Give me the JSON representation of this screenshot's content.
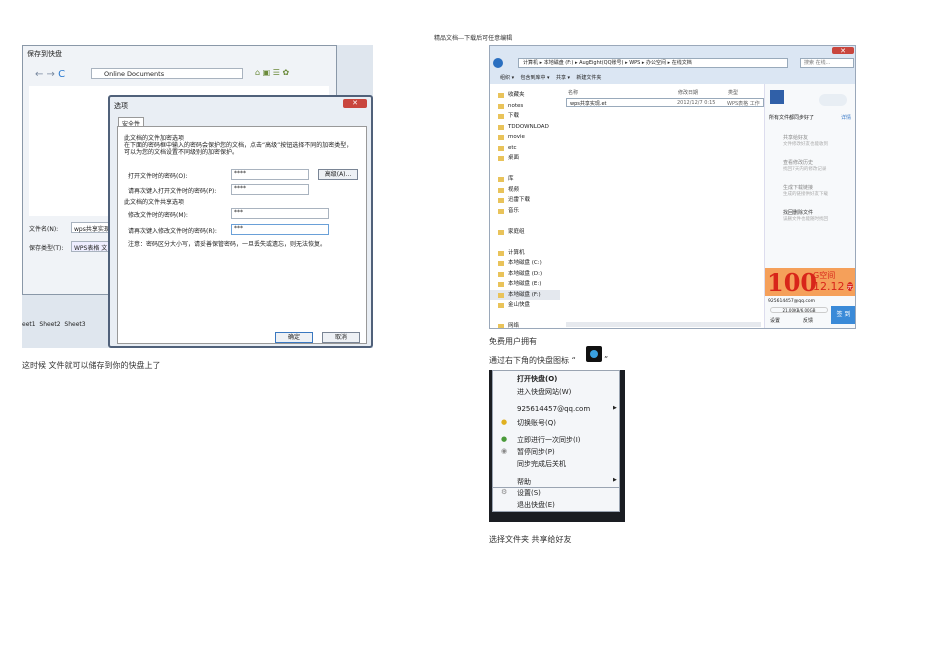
{
  "header": "精品文档---下载后可任意编辑",
  "shot1": {
    "save_title": "保存到快盘",
    "location": "Online Documents",
    "filename_label": "文件名(N):",
    "filename": "wps共享实现",
    "filetype_label": "保存类型(T):",
    "filetype": "WPS表格 文",
    "sheets": [
      "eet1",
      "Sheet2",
      "Sheet3"
    ],
    "dialog_title": "选项",
    "tab": "安全性",
    "enc_section": "此文档的文件加密选项",
    "enc_desc": "在下面的密码框中输入的密码会保护您的文档，点击“高级”按钮选择不同的加密类型，可以为您的文档设置不同级别的加密保护。",
    "open_pw_label": "打开文件时的密码(O):",
    "open_pw": "****",
    "advanced": "高级(A)...",
    "open_pw2_label": "请再次键入打开文件时的密码(P):",
    "open_pw2": "****",
    "share_section": "此文档的文件共享选项",
    "mod_pw_label": "修改文件时的密码(M):",
    "mod_pw": "***",
    "mod_pw2_label": "请再次键入修改文件时的密码(R):",
    "mod_pw2": "***",
    "note": "注意：密码区分大小写，请妥善保管密码，一旦丢失或遗忘，则无法恢复。",
    "ok": "确定",
    "cancel": "取消"
  },
  "caption1": "这时候  文件就可以储存到你的快盘上了",
  "shot2": {
    "breadcrumb": [
      "计算机",
      "本地磁盘 (F:)",
      "AugEight(QQ账号)",
      "WPS",
      "办公空间",
      "在线文档"
    ],
    "search": "搜索 在线...",
    "toolbar": [
      "组织 ▾",
      "包含到库中 ▾",
      "共享 ▾",
      "新建文件夹"
    ],
    "columns": [
      "名称",
      "修改日期",
      "类型"
    ],
    "file": {
      "name": "wps共享实现.et",
      "date": "2012/12/7 0:15",
      "type": "WPS表格 工作"
    },
    "nav": [
      "收藏夹",
      "notes",
      "下载",
      "TDDOWNLOAD",
      "movie",
      "etc",
      "桌面",
      "",
      "库",
      "视频",
      "迅雷下载",
      "音乐",
      "",
      "家庭组",
      "",
      "计算机",
      "本地磁盘 (C:)",
      "本地磁盘 (D:)",
      "本地磁盘 (E:)",
      "本地磁盘 (F:)",
      "金山快盘",
      "",
      "网络"
    ],
    "sync_status": "所有文件都同步好了",
    "details": "详情",
    "actions": [
      {
        "title": "共享给好友",
        "desc": "文件修改好友也能收到"
      },
      {
        "title": "查看修改历史",
        "desc": "找回7天内的修改记录"
      },
      {
        "title": "生成下载链接",
        "desc": "生成的链接供好友下载"
      },
      {
        "title": "找回删除文件",
        "desc": "误删文件也能随时找回"
      }
    ],
    "promo_big": "100",
    "promo_g": "G空间",
    "promo_price": "12.12",
    "promo_yuan": "元",
    "account": "925614457@qq.com",
    "usage": "21.00KB/6.00GB",
    "settings": "设置",
    "feedback": "反馈",
    "checkin": "签 到"
  },
  "caption2": "免费用户拥有",
  "caption3": "通过右下角的快盘图标 “",
  "caption3_end": "”",
  "menu": [
    "打开快盘(O)",
    "进入快盘网站(W)",
    "925614457@qq.com",
    "切换账号(Q)",
    "立即进行一次同步(I)",
    "暂停同步(P)",
    "同步完成后关机",
    "帮助",
    "设置(S)",
    "退出快盘(E)"
  ],
  "caption4": "选择文件夹 共享给好友"
}
